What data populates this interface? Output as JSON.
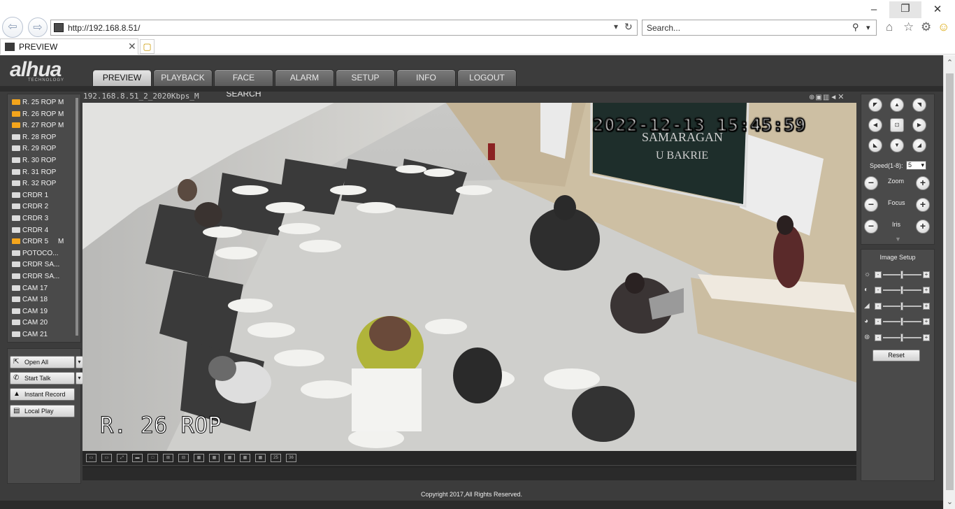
{
  "browser": {
    "url": "http://192.168.8.51/",
    "search_placeholder": "Search...",
    "tab_title": "PREVIEW"
  },
  "app": {
    "logo": "alhua",
    "logo_sub": "TECHNOLOGY",
    "nav": [
      "PREVIEW",
      "PLAYBACK",
      "FACE SEARCH",
      "ALARM",
      "SETUP",
      "INFO",
      "LOGOUT"
    ],
    "active_nav": "PREVIEW"
  },
  "cameras": [
    {
      "name": "R. 25 ROP",
      "mark": "M",
      "active": true
    },
    {
      "name": "R. 26 ROP",
      "mark": "M",
      "active": true
    },
    {
      "name": "R. 27 ROP",
      "mark": "M",
      "active": true
    },
    {
      "name": "R. 28 ROP",
      "mark": "",
      "active": false
    },
    {
      "name": "R. 29 ROP",
      "mark": "",
      "active": false
    },
    {
      "name": "R. 30 ROP",
      "mark": "",
      "active": false
    },
    {
      "name": "R. 31 ROP",
      "mark": "",
      "active": false
    },
    {
      "name": "R. 32 ROP",
      "mark": "",
      "active": false
    },
    {
      "name": "CRDR 1",
      "mark": "",
      "active": false
    },
    {
      "name": "CRDR 2",
      "mark": "",
      "active": false
    },
    {
      "name": "CRDR 3",
      "mark": "",
      "active": false
    },
    {
      "name": "CRDR 4",
      "mark": "",
      "active": false
    },
    {
      "name": "CRDR 5",
      "mark": "M",
      "active": true
    },
    {
      "name": "POTOCO...",
      "mark": "",
      "active": false
    },
    {
      "name": "CRDR SA...",
      "mark": "",
      "active": false
    },
    {
      "name": "CRDR SA...",
      "mark": "",
      "active": false
    },
    {
      "name": "CAM 17",
      "mark": "",
      "active": false
    },
    {
      "name": "CAM 18",
      "mark": "",
      "active": false
    },
    {
      "name": "CAM 19",
      "mark": "",
      "active": false
    },
    {
      "name": "CAM 20",
      "mark": "",
      "active": false
    },
    {
      "name": "CAM 21",
      "mark": "",
      "active": false
    }
  ],
  "controls": {
    "open_all": "Open All",
    "start_talk": "Start Talk",
    "instant_record": "Instant Record",
    "local_play": "Local Play"
  },
  "video": {
    "title": "192.168.8.51_2_2020Kbps_M",
    "osd_time": "2022-12-13 15:45:59",
    "osd_name": "R. 26 ROP",
    "bar_buttons": [
      "▭",
      "▭",
      "⤢",
      "▬",
      "□",
      "⊞",
      "⊟",
      "▦",
      "▦",
      "▦",
      "▦",
      "▦",
      "25",
      "36"
    ]
  },
  "ptz": {
    "speed_label": "Speed(1-8):",
    "speed_value": "5",
    "zoom": "Zoom",
    "focus": "Focus",
    "iris": "Iris"
  },
  "image_setup": {
    "title": "Image Setup",
    "reset": "Reset"
  },
  "footer": "Copyright 2017,All Rights Reserved."
}
